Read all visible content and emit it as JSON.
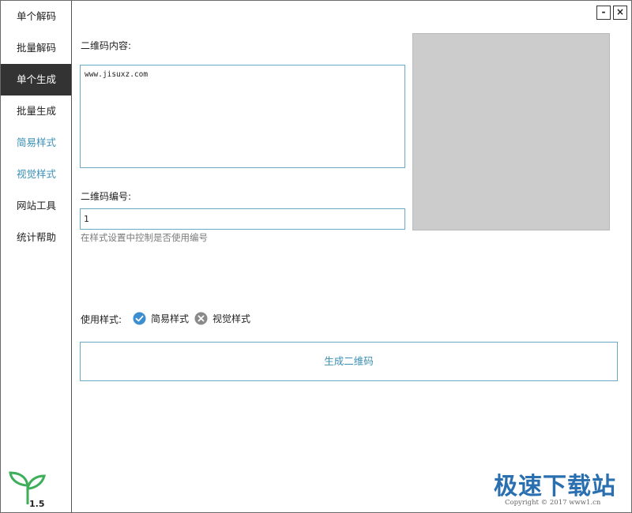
{
  "sidebar": {
    "items": [
      {
        "label": "单个解码"
      },
      {
        "label": "批量解码"
      },
      {
        "label": "单个生成"
      },
      {
        "label": "批量生成"
      },
      {
        "label": "简易样式"
      },
      {
        "label": "视觉样式"
      },
      {
        "label": "网站工具"
      },
      {
        "label": "统计帮助"
      }
    ],
    "active_index": 2,
    "version": "1.5"
  },
  "window_controls": {
    "minimize": "-",
    "close": "×"
  },
  "form": {
    "content_label": "二维码内容:",
    "content_value": "www.jisuxz.com",
    "number_label": "二维码编号:",
    "number_value": "1",
    "number_hint": "在样式设置中控制是否使用编号",
    "style_label": "使用样式:",
    "style_options": [
      {
        "label": "简易样式",
        "state": "checked"
      },
      {
        "label": "视觉样式",
        "state": "unchecked"
      }
    ],
    "generate_button": "生成二维码"
  },
  "colors": {
    "accent": "#3a8fb3",
    "check_blue": "#3b8ed0",
    "unchecked_gray": "#8a8a8a",
    "preview_bg": "#cccccc",
    "active_nav_bg": "#333333",
    "logo_green": "#3dae5a"
  },
  "watermark": {
    "title": "极速下载站",
    "copyright": "Copyright © 2017 www1.cn"
  }
}
